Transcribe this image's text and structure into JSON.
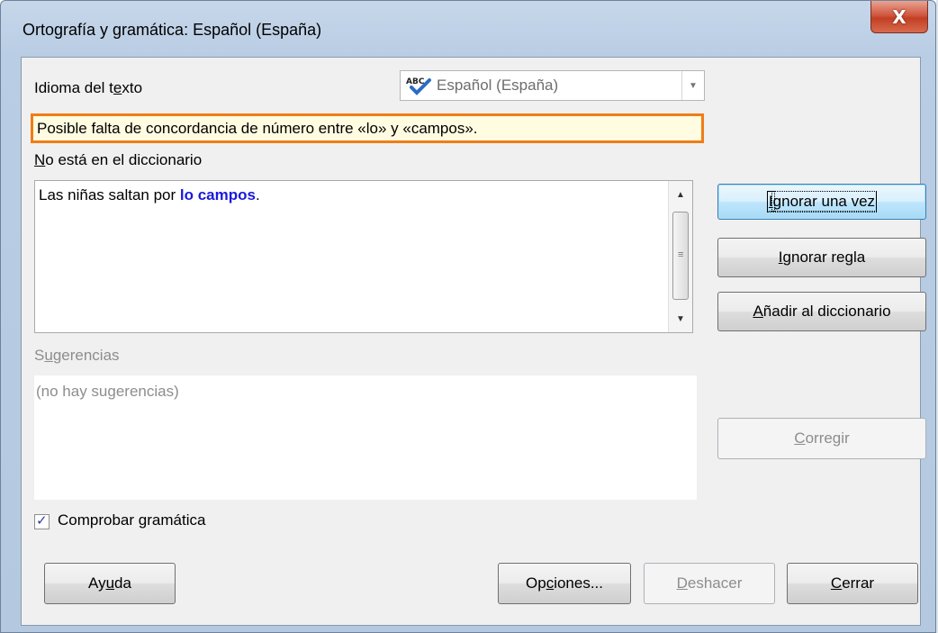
{
  "window": {
    "title": "Ortografía y gramática: Español (España)",
    "close_symbol": "X"
  },
  "language": {
    "label_pre": "Idioma del t",
    "label_key": "e",
    "label_post": "xto",
    "selected": "Español (España)"
  },
  "error_message": "Posible falta de concordancia de número entre «lo» y «campos».",
  "not_in_dictionary": {
    "label_key": "N",
    "label_post": "o está en el diccionario"
  },
  "sentence": {
    "before": "Las niñas saltan por ",
    "highlight": "lo campos",
    "after": "."
  },
  "suggestions": {
    "label_pre": "S",
    "label_key": "u",
    "label_post": "gerencias",
    "empty_text": "(no hay sugerencias)"
  },
  "check_grammar": {
    "label_pre": "Comprobar ",
    "label_key": "g",
    "label_post": "ramática",
    "checked": true
  },
  "buttons": {
    "ignore_once": {
      "key": "I",
      "rest": "gnorar una vez"
    },
    "ignore_rule": {
      "key": "I",
      "rest": "gnorar regla"
    },
    "add_dict": {
      "key": "A",
      "rest": "ñadir al diccionario"
    },
    "correct": {
      "key": "C",
      "rest": "orregir"
    },
    "help": {
      "pre": "Ay",
      "key": "u",
      "post": "da"
    },
    "options": {
      "pre": "Op",
      "key": "c",
      "post": "iones..."
    },
    "undo": {
      "key": "D",
      "rest": "eshacer"
    },
    "close": {
      "key": "C",
      "rest": "errar"
    }
  }
}
